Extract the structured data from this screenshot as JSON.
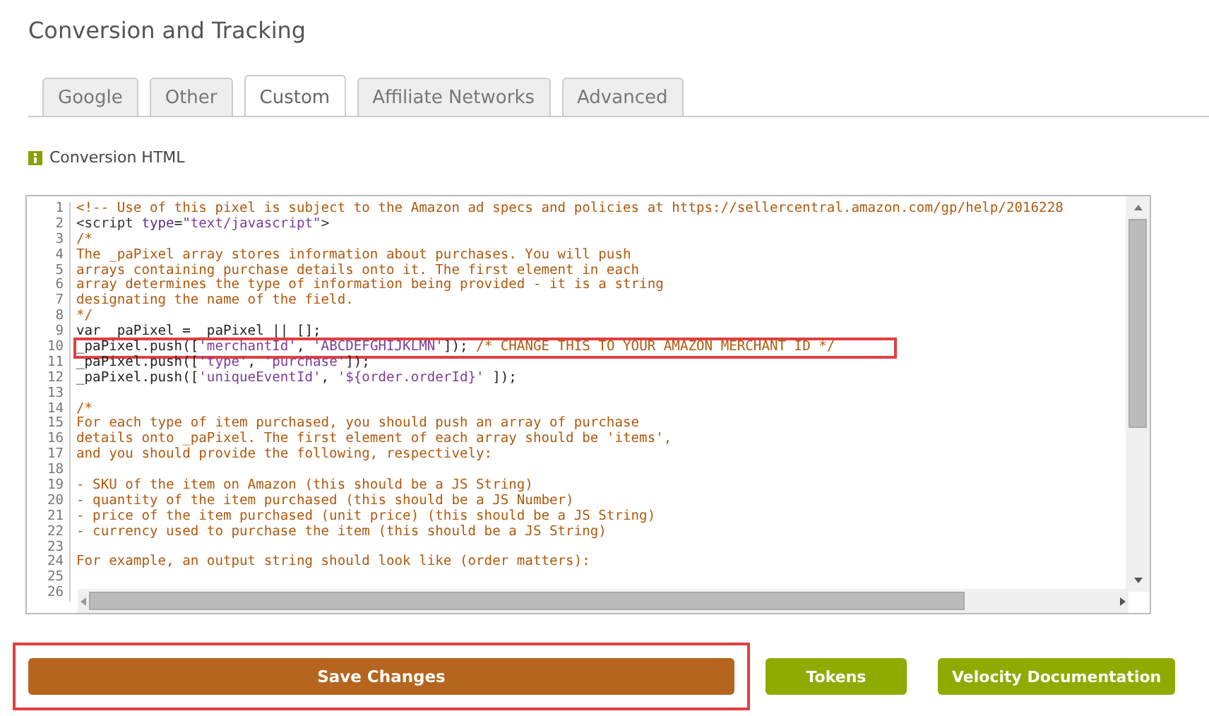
{
  "page_title": "Conversion and Tracking",
  "tabs": [
    {
      "label": "Google",
      "selected": false
    },
    {
      "label": "Other",
      "selected": false
    },
    {
      "label": "Custom",
      "selected": true
    },
    {
      "label": "Affiliate Networks",
      "selected": false
    },
    {
      "label": "Advanced",
      "selected": false
    }
  ],
  "section_label": "Conversion HTML",
  "code_editor": {
    "lines": [
      {
        "number": "1",
        "highlighted": false,
        "segments": [
          {
            "kind": "comment",
            "text": "<!-- Use of this pixel is subject to the Amazon ad specs and policies at https://sellercentral.amazon.com/gp/help/2016228"
          }
        ]
      },
      {
        "number": "2",
        "highlighted": false,
        "segments": [
          {
            "kind": "tag",
            "text": "<script "
          },
          {
            "kind": "attr",
            "text": "type"
          },
          {
            "kind": "tag",
            "text": "="
          },
          {
            "kind": "string",
            "text": "\"text/javascript\""
          },
          {
            "kind": "tag",
            "text": ">"
          }
        ]
      },
      {
        "number": "3",
        "highlighted": false,
        "segments": [
          {
            "kind": "comment",
            "text": "/*"
          }
        ]
      },
      {
        "number": "4",
        "highlighted": false,
        "segments": [
          {
            "kind": "comment",
            "text": "The _paPixel array stores information about purchases. You will push"
          }
        ]
      },
      {
        "number": "5",
        "highlighted": false,
        "segments": [
          {
            "kind": "comment",
            "text": "arrays containing purchase details onto it. The first element in each"
          }
        ]
      },
      {
        "number": "6",
        "highlighted": false,
        "segments": [
          {
            "kind": "comment",
            "text": "array determines the type of information being provided - it is a string"
          }
        ]
      },
      {
        "number": "7",
        "highlighted": false,
        "segments": [
          {
            "kind": "comment",
            "text": "designating the name of the field."
          }
        ]
      },
      {
        "number": "8",
        "highlighted": false,
        "segments": [
          {
            "kind": "comment",
            "text": "*/"
          }
        ]
      },
      {
        "number": "9",
        "highlighted": false,
        "segments": [
          {
            "kind": "plain",
            "text": "var _paPixel = _paPixel || [];"
          }
        ]
      },
      {
        "number": "10",
        "highlighted": true,
        "segments": [
          {
            "kind": "plain",
            "text": "_paPixel.push(["
          },
          {
            "kind": "string",
            "text": "'merchantId'"
          },
          {
            "kind": "plain",
            "text": ", "
          },
          {
            "kind": "string",
            "text": "'ABCDEFGHIJKLMN'"
          },
          {
            "kind": "plain",
            "text": "]); "
          },
          {
            "kind": "comment",
            "text": "/* CHANGE THIS TO YOUR AMAZON MERCHANT ID */"
          }
        ]
      },
      {
        "number": "11",
        "highlighted": false,
        "segments": [
          {
            "kind": "plain",
            "text": "_paPixel.push(["
          },
          {
            "kind": "string",
            "text": "'type'"
          },
          {
            "kind": "plain",
            "text": ", "
          },
          {
            "kind": "string",
            "text": "'purchase'"
          },
          {
            "kind": "plain",
            "text": "]);"
          }
        ]
      },
      {
        "number": "12",
        "highlighted": false,
        "segments": [
          {
            "kind": "plain",
            "text": "_paPixel.push(["
          },
          {
            "kind": "string",
            "text": "'uniqueEventId'"
          },
          {
            "kind": "plain",
            "text": ", "
          },
          {
            "kind": "string",
            "text": "'${order.orderId}'"
          },
          {
            "kind": "plain",
            "text": " ]);"
          }
        ]
      },
      {
        "number": "13",
        "highlighted": false
      },
      {
        "number": "14",
        "highlighted": false,
        "segments": [
          {
            "kind": "comment",
            "text": "/*"
          }
        ]
      },
      {
        "number": "15",
        "highlighted": false,
        "segments": [
          {
            "kind": "comment",
            "text": "For each type of item purchased, you should push an array of purchase"
          }
        ]
      },
      {
        "number": "16",
        "highlighted": false,
        "segments": [
          {
            "kind": "comment",
            "text": "details onto _paPixel. The first element of each array should be 'items',"
          }
        ]
      },
      {
        "number": "17",
        "highlighted": false,
        "segments": [
          {
            "kind": "comment",
            "text": "and you should provide the following, respectively:"
          }
        ]
      },
      {
        "number": "18",
        "highlighted": false
      },
      {
        "number": "19",
        "highlighted": false,
        "segments": [
          {
            "kind": "comment",
            "text": "- SKU of the item on Amazon (this should be a JS String)"
          }
        ]
      },
      {
        "number": "20",
        "highlighted": false,
        "segments": [
          {
            "kind": "comment",
            "text": "- quantity of the item purchased (this should be a JS Number)"
          }
        ]
      },
      {
        "number": "21",
        "highlighted": false,
        "segments": [
          {
            "kind": "comment",
            "text": "- price of the item purchased (unit price) (this should be a JS String)"
          }
        ]
      },
      {
        "number": "22",
        "highlighted": false,
        "segments": [
          {
            "kind": "comment",
            "text": "- currency used to purchase the item (this should be a JS String)"
          }
        ]
      },
      {
        "number": "23",
        "highlighted": false
      },
      {
        "number": "24",
        "highlighted": false,
        "segments": [
          {
            "kind": "comment",
            "text": "For example, an output string should look like (order matters):"
          }
        ]
      },
      {
        "number": "25",
        "highlighted": false
      },
      {
        "number": "26",
        "highlighted": false
      }
    ]
  },
  "buttons": [
    {
      "label": "Save Changes",
      "kind": "primary",
      "highlighted": true
    },
    {
      "label": "Tokens",
      "kind": "secondary",
      "highlighted": false
    },
    {
      "label": "Velocity Documentation",
      "kind": "secondary",
      "highlighted": false
    }
  ]
}
